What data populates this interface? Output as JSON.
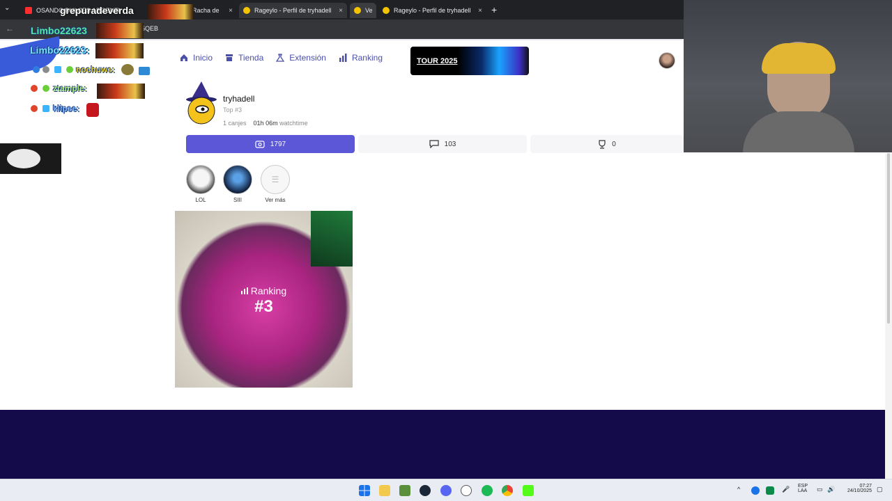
{
  "browser": {
    "tabs": [
      {
        "title": "OSANDO DULCES ARGENTI",
        "active": false
      },
      {
        "title": "Racha de",
        "active": false
      },
      {
        "title": "Rageylo - Perfil de tryhadell",
        "active": true
      },
      {
        "title": "Ve",
        "active": false
      },
      {
        "title": "Rageylo - Perfil de tryhadell",
        "active": false
      }
    ],
    "url_fragment": "5QEB",
    "new_tab": "+",
    "tab_close": "×",
    "back": "←"
  },
  "overlay": {
    "title_fragment": "grepuradeverda",
    "chat_users": [
      "Limbo22623",
      "Limbo22623:",
      "nochuws:",
      "ztample:",
      "klipse:"
    ]
  },
  "site": {
    "nav": [
      {
        "label": "Inicio",
        "icon": "home-icon"
      },
      {
        "label": "Tienda",
        "icon": "store-icon"
      },
      {
        "label": "Extensión",
        "icon": "flask-icon"
      },
      {
        "label": "Ranking",
        "icon": "bar-chart-icon"
      }
    ],
    "tour_label": "TOUR 2025",
    "profile": {
      "name": "tryhadell",
      "rank": "Top #3",
      "canjes": "1 canjes",
      "watchtime_value": "01h 06m",
      "watchtime_label": "watchtime"
    },
    "stats": [
      {
        "value": "1797",
        "icon": "eye-icon",
        "primary": true
      },
      {
        "value": "103",
        "icon": "chat-icon",
        "primary": false
      },
      {
        "value": "0",
        "icon": "trophy-icon",
        "primary": false
      }
    ],
    "badges": [
      "LOL",
      "SIII",
      "Ver más"
    ],
    "card": {
      "label": "Ranking",
      "value": "#3"
    }
  },
  "taskbar": {
    "lang": "ESP",
    "layout": "LAA",
    "time": "07:27",
    "date": "24/10/2025"
  },
  "colors": {
    "accent": "#5b57d6",
    "nav_text": "#4a4fa8",
    "footer": "#140c4a"
  }
}
